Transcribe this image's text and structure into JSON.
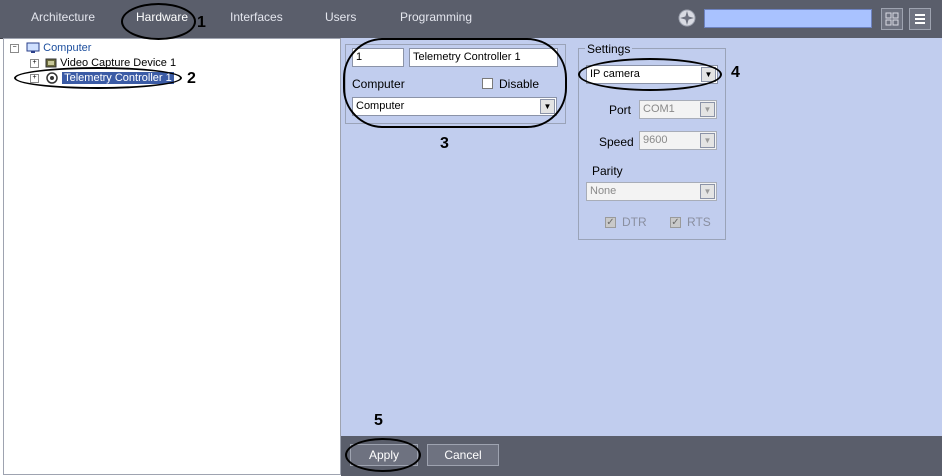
{
  "topbar": {
    "tabs": [
      "Architecture",
      "Hardware",
      "Interfaces",
      "Users",
      "Programming"
    ],
    "search_value": ""
  },
  "tree": {
    "root": "Computer",
    "children": [
      "Video Capture Device 1",
      "Telemetry Controller 1"
    ]
  },
  "main": {
    "id_value": "1",
    "name_value": "Telemetry Controller 1",
    "computer_label": "Computer",
    "disable_label": "Disable",
    "computer_select": "Computer"
  },
  "settings": {
    "title": "Settings",
    "protocol_select": "IP camera",
    "port_label": "Port",
    "port_value": "COM1",
    "speed_label": "Speed",
    "speed_value": "9600",
    "parity_label": "Parity",
    "parity_value": "None",
    "dtr_label": "DTR",
    "rts_label": "RTS",
    "dtr_checked": true,
    "rts_checked": true
  },
  "footer": {
    "apply_label": "Apply",
    "cancel_label": "Cancel"
  },
  "annotations": [
    "1",
    "2",
    "3",
    "4",
    "5"
  ],
  "colors": {
    "toolbar_bg": "#5a5e6b",
    "panel_bg": "#c1cdee",
    "search_bg": "#a9c2ff",
    "selection_bg": "#3b5ba5"
  }
}
